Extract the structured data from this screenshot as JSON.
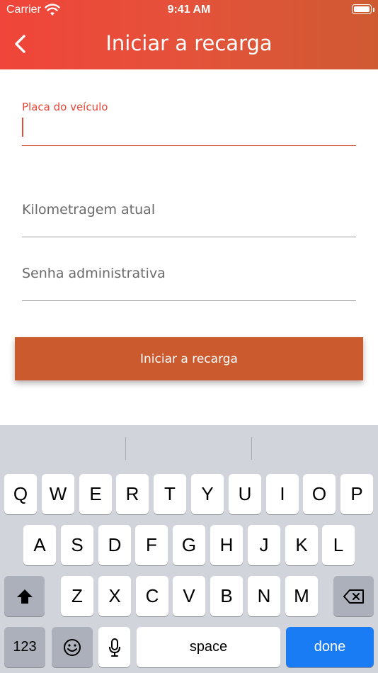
{
  "status_bar": {
    "carrier": "Carrier",
    "time": "9:41 AM"
  },
  "nav": {
    "title": "Iniciar a recarga",
    "back_icon": "chevron-left-icon"
  },
  "form": {
    "plate": {
      "label": "Placa do veículo",
      "value": ""
    },
    "km": {
      "placeholder": "Kilometragem atual",
      "value": ""
    },
    "password": {
      "placeholder": "Senha administrativa",
      "value": ""
    },
    "submit_label": "Iniciar a recarga"
  },
  "keyboard": {
    "row1": [
      "Q",
      "W",
      "E",
      "R",
      "T",
      "Y",
      "U",
      "I",
      "O",
      "P"
    ],
    "row2": [
      "A",
      "S",
      "D",
      "F",
      "G",
      "H",
      "J",
      "K",
      "L"
    ],
    "row3": [
      "Z",
      "X",
      "C",
      "V",
      "B",
      "N",
      "M"
    ],
    "numbers_label": "123",
    "space_label": "space",
    "done_label": "done"
  },
  "colors": {
    "header_start": "#f0453a",
    "header_end": "#cf5a32",
    "accent": "#cb5b2f",
    "done_blue": "#1a7cf5"
  }
}
